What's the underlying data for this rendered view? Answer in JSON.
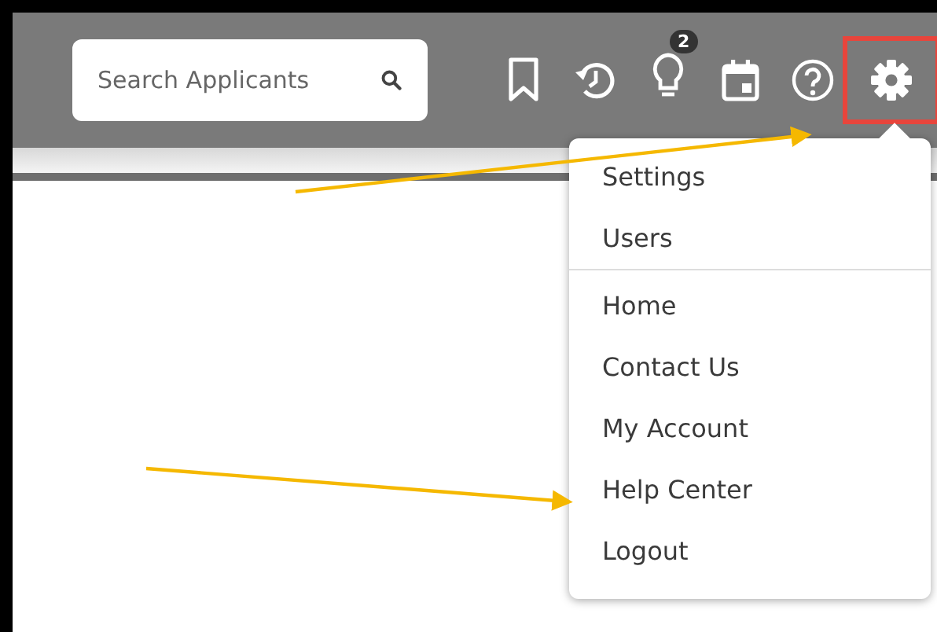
{
  "search": {
    "placeholder": "Search Applicants"
  },
  "toolbar": {
    "icons": [
      {
        "kind": "bookmark"
      },
      {
        "kind": "history"
      },
      {
        "kind": "bulb",
        "badge": "2"
      },
      {
        "kind": "calendar"
      },
      {
        "kind": "help"
      },
      {
        "kind": "gear",
        "highlighted": true
      }
    ]
  },
  "menu": {
    "sections": [
      {
        "items": [
          {
            "label": "Settings"
          },
          {
            "label": "Users"
          }
        ]
      },
      {
        "items": [
          {
            "label": "Home"
          },
          {
            "label": "Contact Us"
          },
          {
            "label": "My Account"
          },
          {
            "label": "Help Center"
          },
          {
            "label": "Logout"
          }
        ]
      }
    ]
  }
}
